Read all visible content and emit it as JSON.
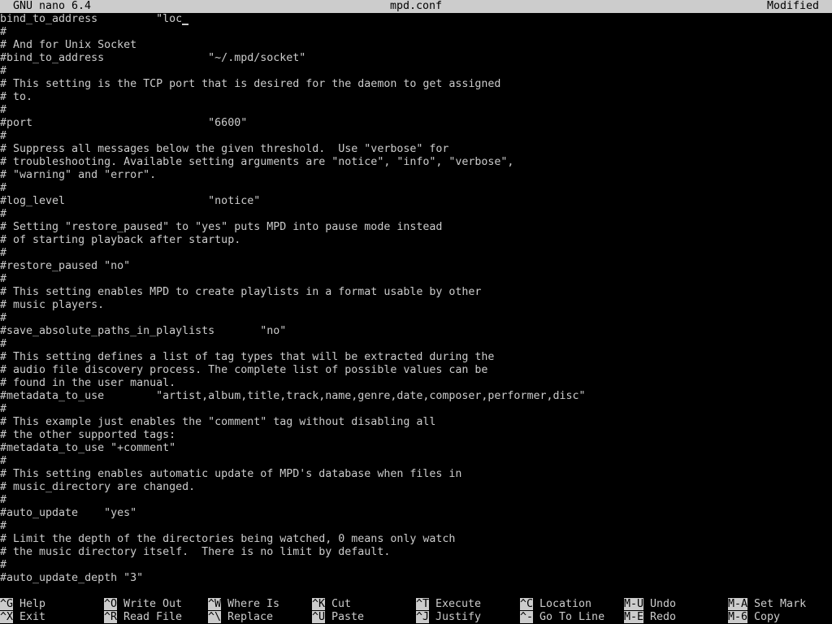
{
  "titlebar": {
    "app": "GNU nano 6.4",
    "filename": "mpd.conf",
    "status": "Modified"
  },
  "editor": {
    "first_line_text": "bind_to_address         \"loc",
    "lines": [
      "#",
      "# And for Unix Socket",
      "#bind_to_address                \"~/.mpd/socket\"",
      "#",
      "# This setting is the TCP port that is desired for the daemon to get assigned",
      "# to.",
      "#",
      "#port                           \"6600\"",
      "#",
      "# Suppress all messages below the given threshold.  Use \"verbose\" for",
      "# troubleshooting. Available setting arguments are \"notice\", \"info\", \"verbose\",",
      "# \"warning\" and \"error\".",
      "#",
      "#log_level                      \"notice\"",
      "#",
      "# Setting \"restore_paused\" to \"yes\" puts MPD into pause mode instead",
      "# of starting playback after startup.",
      "#",
      "#restore_paused \"no\"",
      "#",
      "# This setting enables MPD to create playlists in a format usable by other",
      "# music players.",
      "#",
      "#save_absolute_paths_in_playlists       \"no\"",
      "#",
      "# This setting defines a list of tag types that will be extracted during the",
      "# audio file discovery process. The complete list of possible values can be",
      "# found in the user manual.",
      "#metadata_to_use        \"artist,album,title,track,name,genre,date,composer,performer,disc\"",
      "#",
      "# This example just enables the \"comment\" tag without disabling all",
      "# the other supported tags:",
      "#metadata_to_use \"+comment\"",
      "#",
      "# This setting enables automatic update of MPD's database when files in",
      "# music_directory are changed.",
      "#",
      "#auto_update    \"yes\"",
      "#",
      "# Limit the depth of the directories being watched, 0 means only watch",
      "# the music directory itself.  There is no limit by default.",
      "#",
      "#auto_update_depth \"3\""
    ]
  },
  "shortcuts": [
    {
      "key": "^G",
      "label": "Help"
    },
    {
      "key": "^X",
      "label": "Exit"
    },
    {
      "key": "^O",
      "label": "Write Out"
    },
    {
      "key": "^R",
      "label": "Read File"
    },
    {
      "key": "^W",
      "label": "Where Is"
    },
    {
      "key": "^\\",
      "label": "Replace"
    },
    {
      "key": "^K",
      "label": "Cut"
    },
    {
      "key": "^U",
      "label": "Paste"
    },
    {
      "key": "^T",
      "label": "Execute"
    },
    {
      "key": "^J",
      "label": "Justify"
    },
    {
      "key": "^C",
      "label": "Location"
    },
    {
      "key": "^-",
      "label": "Go To Line"
    },
    {
      "key": "M-U",
      "label": "Undo"
    },
    {
      "key": "M-E",
      "label": "Redo"
    },
    {
      "key": "M-A",
      "label": "Set Mark"
    },
    {
      "key": "M-6",
      "label": "Copy"
    }
  ],
  "colors": {
    "background": "#000000",
    "foreground": "#cccccc",
    "inverse_bg": "#cccccc",
    "inverse_fg": "#000000"
  }
}
